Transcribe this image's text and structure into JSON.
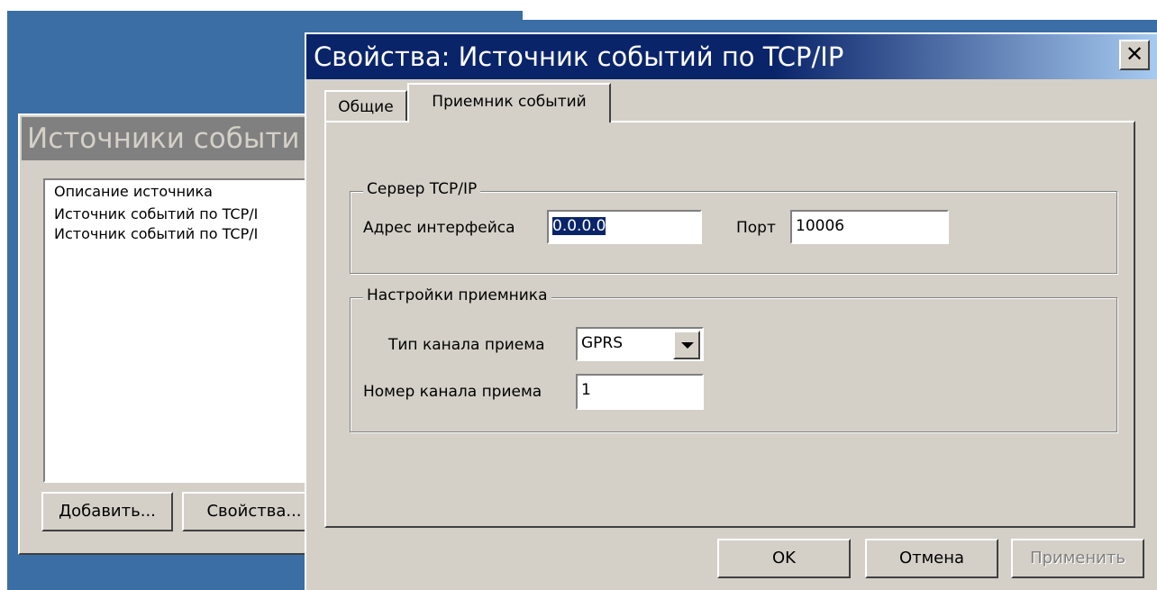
{
  "background_window": {
    "title": "Источники событи",
    "list": {
      "header": "Описание источника",
      "items": [
        "Источник событий по TCP/I",
        "Источник событий по TCP/I"
      ]
    },
    "buttons": {
      "add": "Добавить...",
      "properties": "Свойства..."
    }
  },
  "dialog": {
    "title": "Свойства: Источник событий по TCP/IP",
    "close_glyph": "✕",
    "tabs": [
      {
        "label": "Общие",
        "active": false
      },
      {
        "label": "Приемник событий",
        "active": true
      }
    ],
    "server_group": {
      "legend": "Сервер TCP/IP",
      "address_label": "Адрес интерфейса",
      "address_value": "0.0.0.0",
      "port_label": "Порт",
      "port_value": "10006"
    },
    "receiver_group": {
      "legend": "Настройки приемника",
      "channel_type_label": "Тип канала приема",
      "channel_type_value": "GPRS",
      "channel_number_label": "Номер канала приема",
      "channel_number_value": "1"
    },
    "buttons": {
      "ok": "OK",
      "cancel": "Отмена",
      "apply": "Применить"
    }
  },
  "colors": {
    "desktop": "#3a6ea5",
    "titlebar_active": "#0a246a",
    "face": "#d4d0c8"
  }
}
